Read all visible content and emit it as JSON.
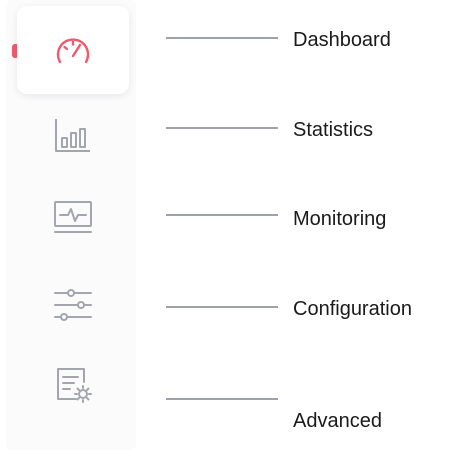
{
  "nav": {
    "active_color": "#ef5a6d",
    "icon_color": "#a3a7ad",
    "items": [
      {
        "label": "Dashboard",
        "icon": "speedometer-icon",
        "active": true
      },
      {
        "label": "Statistics",
        "icon": "bar-chart-icon",
        "active": false
      },
      {
        "label": "Monitoring",
        "icon": "monitor-pulse-icon",
        "active": false
      },
      {
        "label": "Configuration",
        "icon": "sliders-icon",
        "active": false
      },
      {
        "label": "Advanced",
        "icon": "document-gear-icon",
        "active": false
      }
    ]
  }
}
